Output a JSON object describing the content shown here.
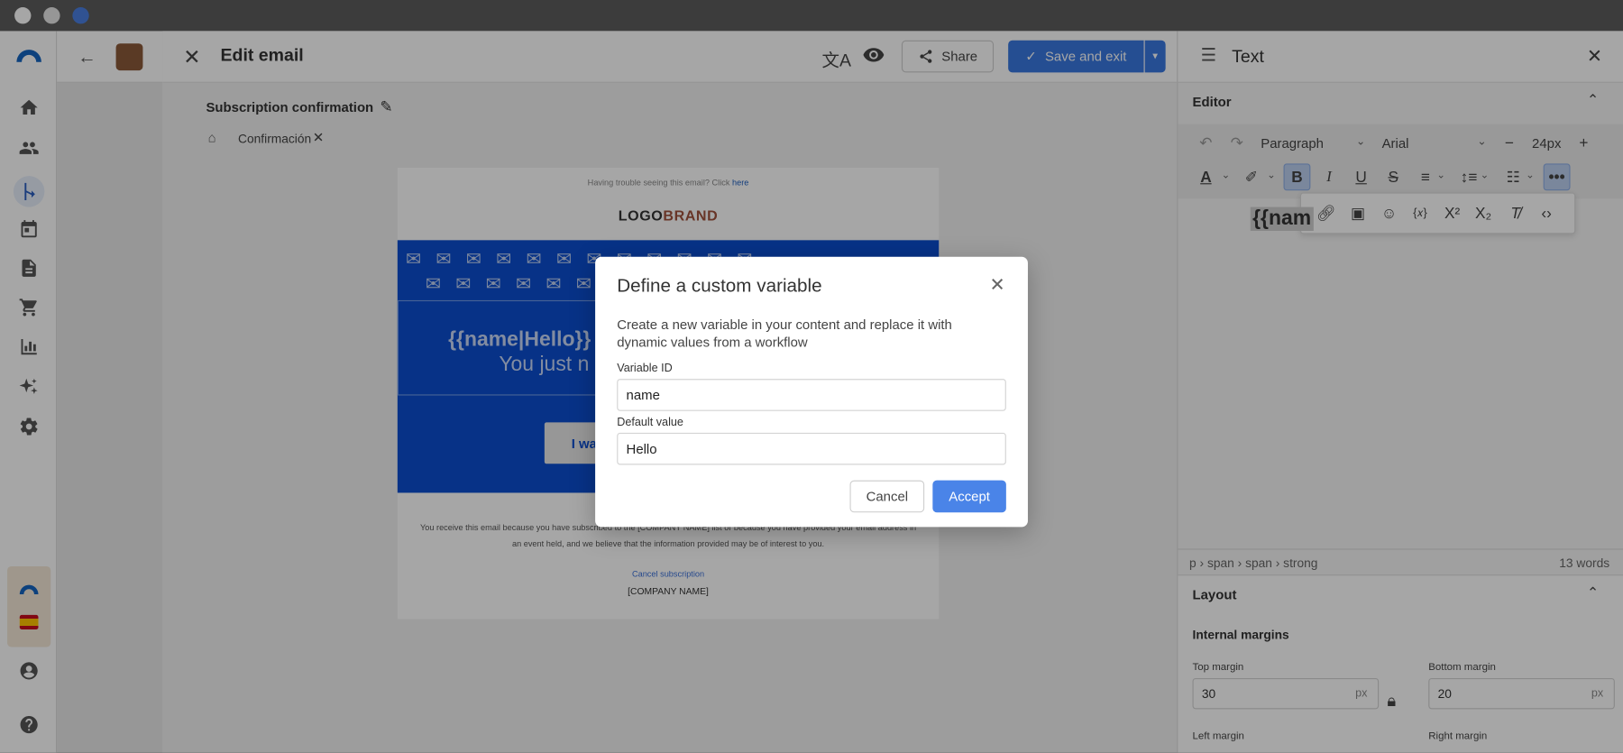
{
  "app": {
    "window_dots": [
      "#ffffff",
      "#e8e8e8",
      "#4a7fe0"
    ]
  },
  "sidebar": {
    "items": [
      {
        "name": "home-icon"
      },
      {
        "name": "contacts-icon"
      },
      {
        "name": "automation-icon"
      },
      {
        "name": "calendar-icon"
      },
      {
        "name": "templates-icon"
      },
      {
        "name": "cart-icon"
      },
      {
        "name": "reports-icon"
      },
      {
        "name": "ai-sparkle-icon"
      },
      {
        "name": "settings-icon"
      }
    ]
  },
  "editor": {
    "title": "Edit email",
    "share_label": "Share",
    "save_label": "Save and exit",
    "email_name": "Subscription confirmation",
    "tag": "Confirmación"
  },
  "email": {
    "trouble_text": "Having trouble seeing this email? Click",
    "trouble_link": "here",
    "logo_a": "LOGO",
    "logo_b": "BRAND",
    "hero_title": "{{name|Hello}}",
    "hero_sub": "You just n",
    "cta": "I wa",
    "footer_text": "You receive this email because you have subscribed to the [COMPANY NAME] list or because you have provided your email address in an event held, and we believe that the information provided may be of interest to you.",
    "cancel_link": "Cancel subscription",
    "company": "[COMPANY NAME]"
  },
  "right_panel": {
    "title": "Text",
    "editor_section": "Editor",
    "block_format": "Paragraph",
    "font": "Arial",
    "font_size": "24px",
    "preview_text": "{{nam",
    "breadcrumb": "p › span › span › strong",
    "word_count": "13 words",
    "layout_section": "Layout",
    "internal_margins": "Internal margins",
    "top_margin_label": "Top margin",
    "top_margin_value": "30",
    "bottom_margin_label": "Bottom margin",
    "bottom_margin_value": "20",
    "left_margin_label": "Left margin",
    "right_margin_label": "Right margin",
    "unit": "px"
  },
  "modal": {
    "title": "Define a custom variable",
    "description": "Create a new variable in your content and replace it with dynamic values from a workflow",
    "variable_id_label": "Variable ID",
    "variable_id_value": "name",
    "default_value_label": "Default value",
    "default_value_value": "Hello",
    "cancel_label": "Cancel",
    "accept_label": "Accept"
  },
  "colors": {
    "accent": "#4a7fe0",
    "primary_btn": "#3a78e0",
    "email_blue": "#0b4ecf",
    "sidebar_logo": "#1565c0"
  }
}
